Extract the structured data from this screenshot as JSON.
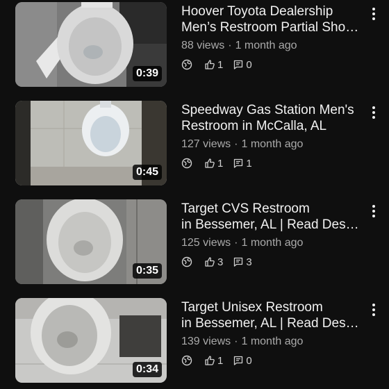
{
  "videos": [
    {
      "title_line1": "Hoover Toyota Dealership",
      "title_line2": "Men’s Restroom Partial Shoo…",
      "views": "88 views",
      "age": "1 month ago",
      "duration": "0:39",
      "likes": "1",
      "comments": "0",
      "visibility_icon": "globe-icon"
    },
    {
      "title_line1": "Speedway Gas Station Men's",
      "title_line2": "Restroom in McCalla, AL",
      "views": "127 views",
      "age": "1 month ago",
      "duration": "0:45",
      "likes": "1",
      "comments": "1",
      "visibility_icon": "globe-icon"
    },
    {
      "title_line1": "Target CVS Restroom",
      "title_line2": "in Bessemer, AL | Read Desc…",
      "views": "125 views",
      "age": "1 month ago",
      "duration": "0:35",
      "likes": "3",
      "comments": "3",
      "visibility_icon": "globe-icon"
    },
    {
      "title_line1": "Target Unisex Restroom",
      "title_line2": "in Bessemer, AL | Read Desc…",
      "views": "139 views",
      "age": "1 month ago",
      "duration": "0:34",
      "likes": "1",
      "comments": "0",
      "visibility_icon": "globe-icon"
    }
  ],
  "meta_separator": "·",
  "colors": {
    "background": "#0f0f0f",
    "title_text": "#f1f1f1",
    "meta_text": "#aaaaaa"
  }
}
